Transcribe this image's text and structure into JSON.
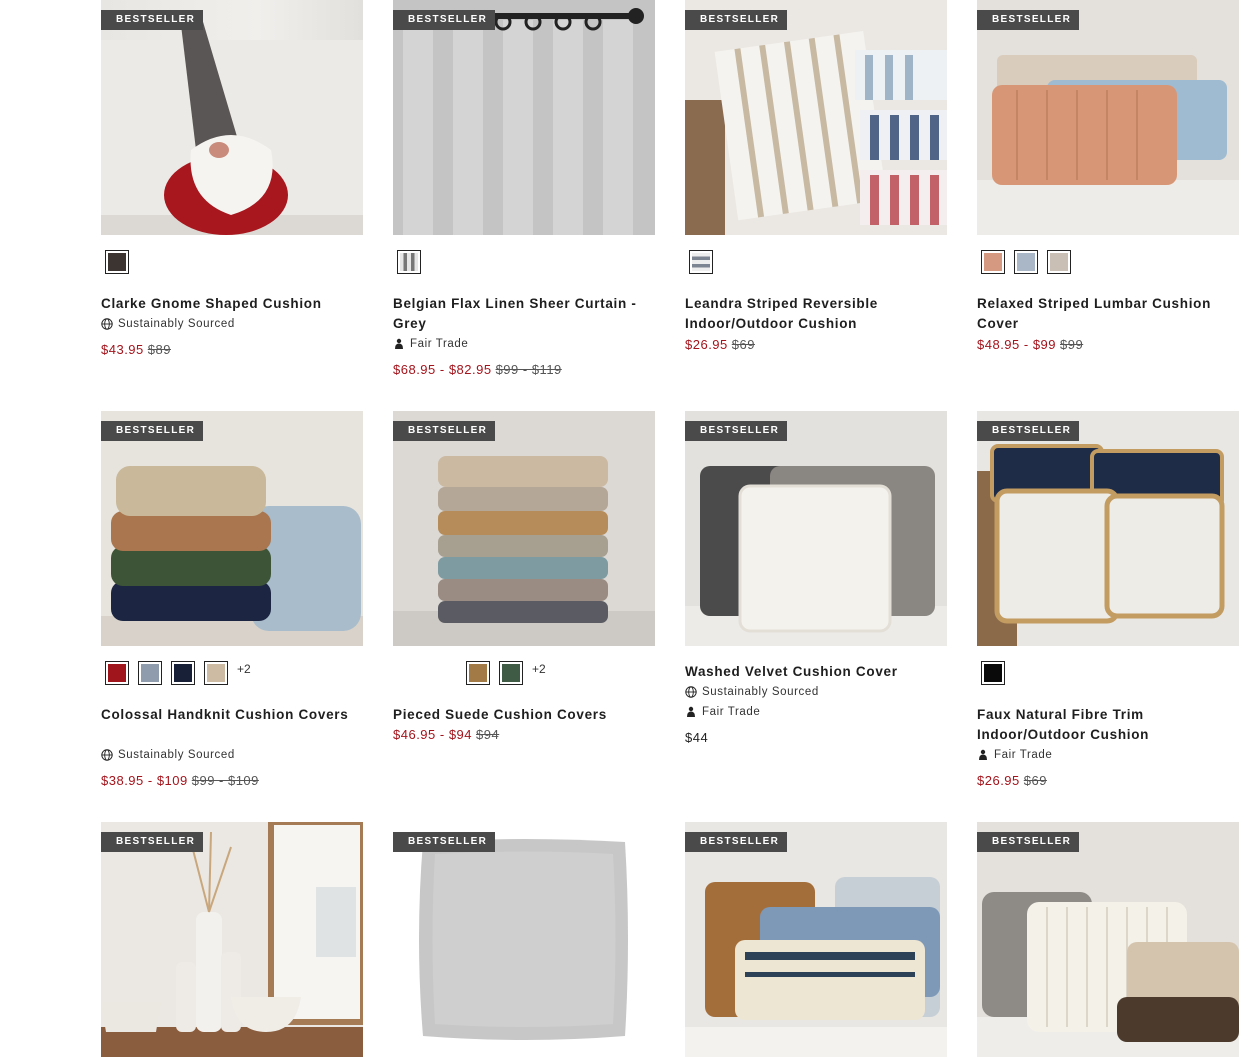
{
  "badge_text": "BESTSELLER",
  "colors": {
    "sale_price": "#a4141c",
    "badge_bg": "#4a4a4a"
  },
  "products": [
    {
      "name": "Clarke Gnome Shaped Cushion",
      "attributes": [
        "Sustainably Sourced"
      ],
      "sale_price": "$43.95",
      "original_price": "$89",
      "swatches": [
        "#3b3430"
      ],
      "more": ""
    },
    {
      "name": "Belgian Flax Linen Sheer Curtain - Grey",
      "attributes": [
        "Fair Trade"
      ],
      "sale_price": "$68.95 - $82.95",
      "original_price": "$99 - $119",
      "swatches": [
        "#9a9a9a"
      ],
      "more": ""
    },
    {
      "name": "Leandra Striped Reversible Indoor/Outdoor Cushion",
      "attributes": [],
      "sale_price": "$26.95",
      "original_price": "$69",
      "swatches": [
        "#b8bcc3"
      ],
      "more": ""
    },
    {
      "name": "Relaxed Striped Lumbar Cushion Cover",
      "attributes": [],
      "sale_price": "$48.95 - $99",
      "original_price": "$99",
      "swatches": [
        "#d59880",
        "#a9b7c6",
        "#c9bfb5"
      ],
      "more": ""
    },
    {
      "name": "Colossal Handknit Cushion Covers",
      "attributes": [
        "Sustainably Sourced"
      ],
      "sale_price": "$38.95 - $109",
      "original_price": "$99 - $109",
      "swatches": [
        "#a0141c",
        "#8e9cae",
        "#182038",
        "#cdbba4"
      ],
      "more": "+2"
    },
    {
      "name": "Pieced Suede Cushion Covers",
      "attributes": [],
      "sale_price": "$46.95 - $94",
      "original_price": "$94",
      "swatches": [
        "#a27a45",
        "#3f5a45"
      ],
      "more": "+2"
    },
    {
      "name": "Washed Velvet Cushion Cover",
      "attributes": [
        "Sustainably Sourced",
        "Fair Trade"
      ],
      "regular_price": "$44",
      "swatches": [],
      "more": ""
    },
    {
      "name": "Faux Natural Fibre Trim Indoor/Outdoor Cushion",
      "attributes": [
        "Fair Trade"
      ],
      "sale_price": "$26.95",
      "original_price": "$69",
      "swatches": [
        "#0a0a0a"
      ],
      "more": ""
    },
    {
      "name": "",
      "attributes": [],
      "swatches": []
    },
    {
      "name": "",
      "attributes": [],
      "swatches": []
    },
    {
      "name": "",
      "attributes": [],
      "swatches": []
    },
    {
      "name": "",
      "attributes": [],
      "swatches": []
    }
  ]
}
